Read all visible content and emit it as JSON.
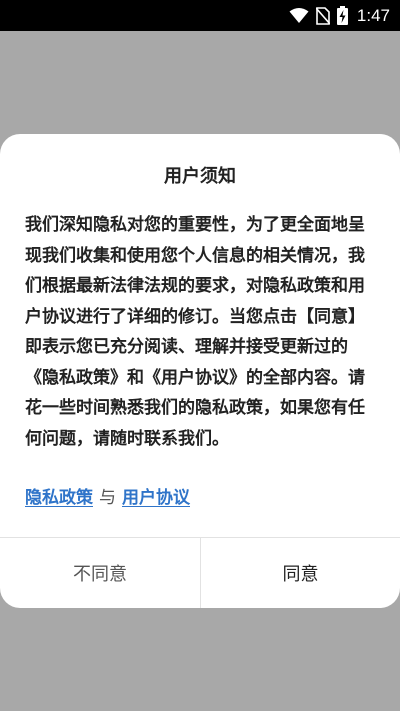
{
  "status_bar": {
    "time": "1:47",
    "icons": [
      "wifi-icon",
      "no-sim-icon",
      "battery-charging-icon"
    ]
  },
  "dialog": {
    "title": "用户须知",
    "body": "我们深知隐私对您的重要性，为了更全面地呈现我们收集和使用您个人信息的相关情况，我们根据最新法律法规的要求，对隐私政策和用户协议进行了详细的修订。当您点击【同意】即表示您已充分阅读、理解并接受更新过的《隐私政策》和《用户协议》的全部内容。请花一些时间熟悉我们的隐私政策，如果您有任何问题，请随时联系我们。",
    "privacy_link": "隐私政策",
    "separator": "与",
    "agreement_link": "用户协议",
    "disagree_label": "不同意",
    "agree_label": "同意"
  },
  "colors": {
    "overlay": "#a8a8a8",
    "link": "#2f74c9",
    "text": "#222222"
  }
}
